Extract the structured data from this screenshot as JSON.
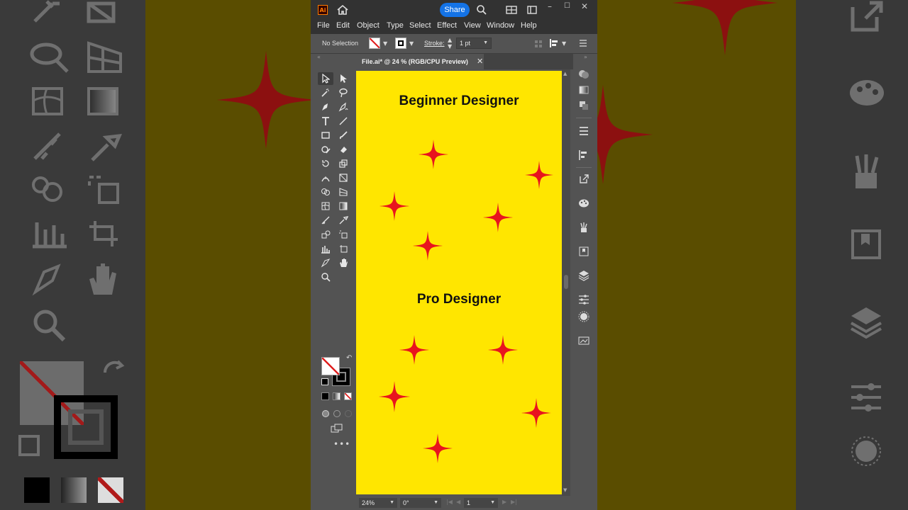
{
  "titlebar": {
    "logo_text": "Ai",
    "share_label": "Share",
    "window_controls": [
      "–",
      "☐",
      "✕"
    ]
  },
  "menubar": {
    "items": [
      "File",
      "Edit",
      "Object",
      "Type",
      "Select",
      "Effect",
      "View",
      "Window",
      "Help"
    ]
  },
  "controlbar": {
    "selection_status": "No Selection",
    "stroke_label": "Stroke:",
    "stroke_weight": "1 pt"
  },
  "document": {
    "tab_title": "File.ai* @ 24 % (RGB/CPU Preview)",
    "close_symbol": "✕"
  },
  "artboard": {
    "background": "#ffe600",
    "star_color": "#e8141e",
    "heading_top": "Beginner Designer",
    "heading_bottom": "Pro Designer"
  },
  "statusbar": {
    "zoom": "24%",
    "rotation": "0°",
    "artboard_number": "1"
  },
  "toolbar": {
    "more_label": "•••"
  },
  "colors": {
    "accent": "#1473e6",
    "app_bg": "#535353",
    "titlebar_bg": "#323232"
  }
}
